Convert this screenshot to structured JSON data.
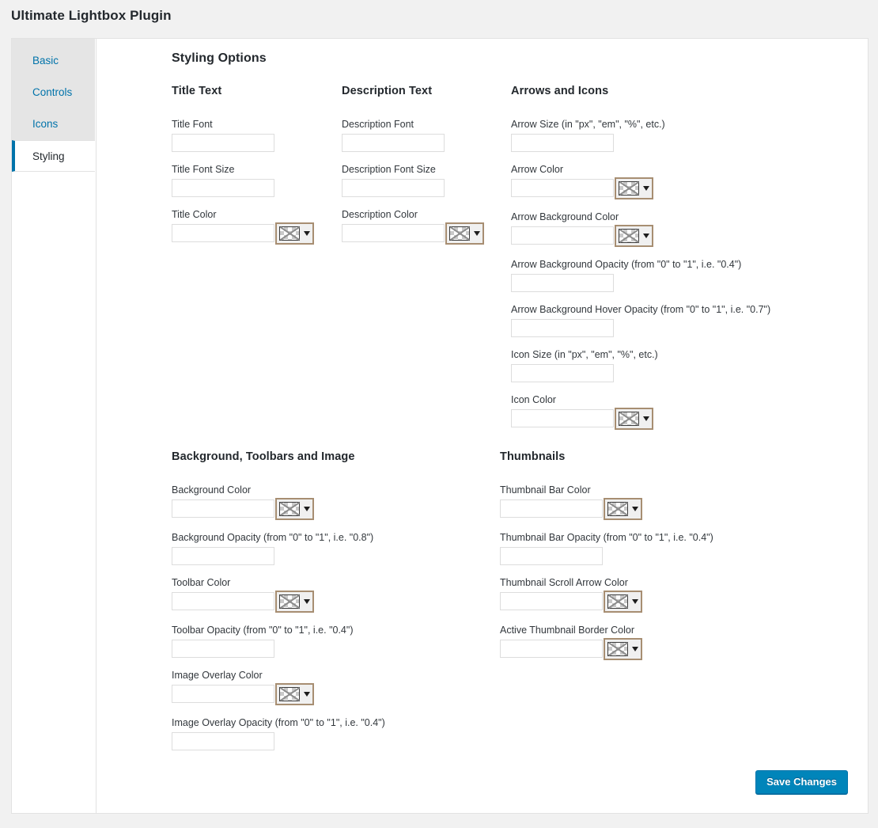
{
  "header": {
    "title": "Ultimate Lightbox Plugin"
  },
  "sidebar": {
    "items": [
      {
        "label": "Basic",
        "active": false
      },
      {
        "label": "Controls",
        "active": false
      },
      {
        "label": "Icons",
        "active": false
      },
      {
        "label": "Styling",
        "active": true
      }
    ]
  },
  "main": {
    "section_title": "Styling Options",
    "columns": {
      "title_text": {
        "heading": "Title Text",
        "fields": [
          {
            "label": "Title Font",
            "value": "",
            "type": "text"
          },
          {
            "label": "Title Font Size",
            "value": "",
            "type": "text"
          },
          {
            "label": "Title Color",
            "value": "",
            "type": "color"
          }
        ]
      },
      "description_text": {
        "heading": "Description Text",
        "fields": [
          {
            "label": "Description Font",
            "value": "",
            "type": "text"
          },
          {
            "label": "Description Font Size",
            "value": "",
            "type": "text"
          },
          {
            "label": "Description Color",
            "value": "",
            "type": "color"
          }
        ]
      },
      "arrows_and_icons": {
        "heading": "Arrows and Icons",
        "fields": [
          {
            "label": "Arrow Size (in \"px\", \"em\", \"%\", etc.)",
            "value": "",
            "type": "text"
          },
          {
            "label": "Arrow Color",
            "value": "",
            "type": "color"
          },
          {
            "label": "Arrow Background Color",
            "value": "",
            "type": "color"
          },
          {
            "label": "Arrow Background Opacity (from \"0\" to \"1\", i.e. \"0.4\")",
            "value": "",
            "type": "text"
          },
          {
            "label": "Arrow Background Hover Opacity (from \"0\" to \"1\", i.e. \"0.7\")",
            "value": "",
            "type": "text"
          },
          {
            "label": "Icon Size (in \"px\", \"em\", \"%\", etc.)",
            "value": "",
            "type": "text"
          },
          {
            "label": "Icon Color",
            "value": "",
            "type": "color"
          }
        ]
      },
      "background_toolbars_image": {
        "heading": "Background, Toolbars and Image",
        "fields": [
          {
            "label": "Background Color",
            "value": "",
            "type": "color"
          },
          {
            "label": "Background Opacity (from \"0\" to \"1\", i.e. \"0.8\")",
            "value": "",
            "type": "text"
          },
          {
            "label": "Toolbar Color",
            "value": "",
            "type": "color"
          },
          {
            "label": "Toolbar Opacity (from \"0\" to \"1\", i.e. \"0.4\")",
            "value": "",
            "type": "text"
          },
          {
            "label": "Image Overlay Color",
            "value": "",
            "type": "color"
          },
          {
            "label": "Image Overlay Opacity (from \"0\" to \"1\", i.e. \"0.4\")",
            "value": "",
            "type": "text"
          }
        ]
      },
      "thumbnails": {
        "heading": "Thumbnails",
        "fields": [
          {
            "label": "Thumbnail Bar Color",
            "value": "",
            "type": "color"
          },
          {
            "label": "Thumbnail Bar Opacity (from \"0\" to \"1\", i.e. \"0.4\")",
            "value": "",
            "type": "text"
          },
          {
            "label": "Thumbnail Scroll Arrow Color",
            "value": "",
            "type": "color"
          },
          {
            "label": "Active Thumbnail Border Color",
            "value": "",
            "type": "color"
          }
        ]
      }
    }
  },
  "footer": {
    "save_label": "Save Changes"
  },
  "colors": {
    "accent": "#0073aa",
    "save_button": "#0085ba",
    "page_background": "#f1f1f1",
    "sidebar_background": "#e5e5e5",
    "card_background": "#ffffff",
    "color_picker_border": "#a78e72"
  }
}
